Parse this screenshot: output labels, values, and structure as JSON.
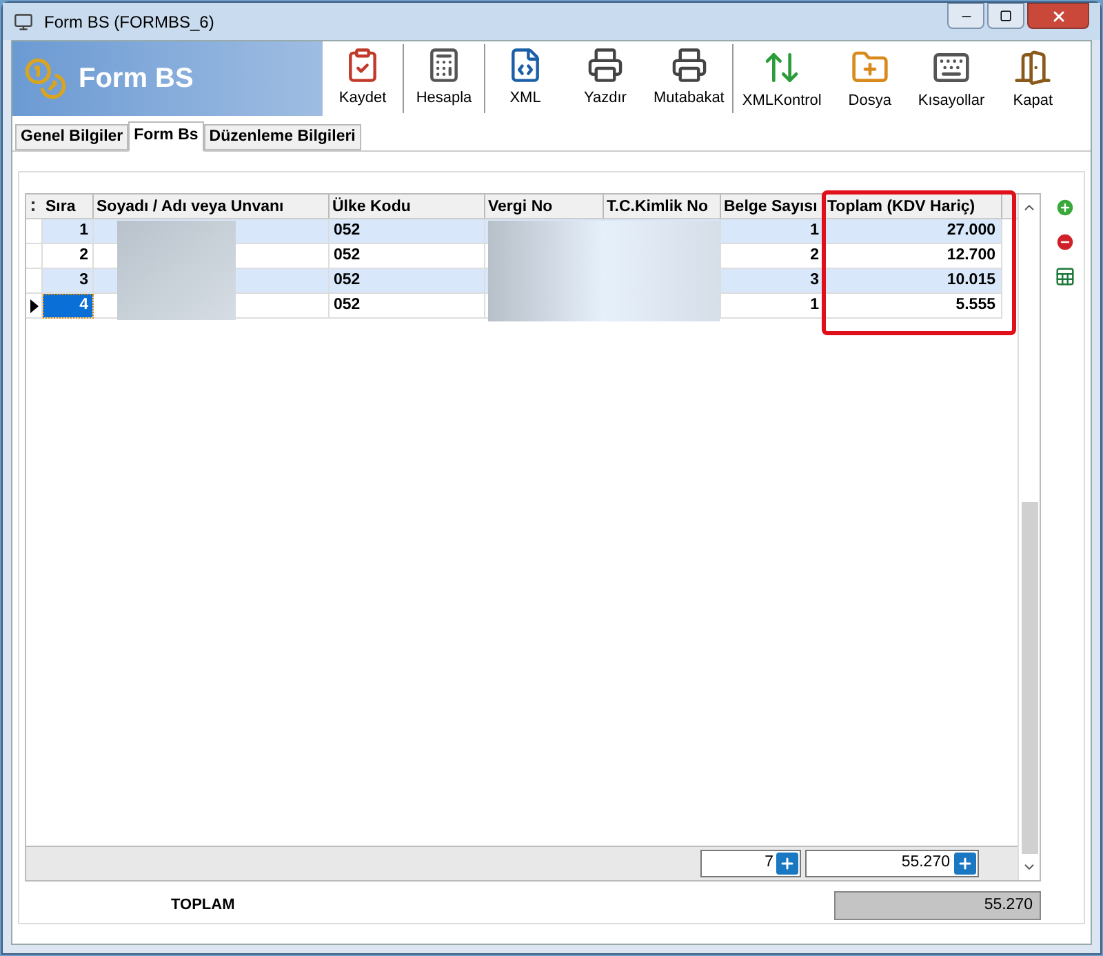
{
  "window": {
    "title": "Form BS (FORMBS_6)"
  },
  "header": {
    "title": "Form BS"
  },
  "toolbar_groups": [
    [
      {
        "label": "Kaydet"
      }
    ],
    [
      {
        "label": "Hesapla"
      }
    ],
    [
      {
        "label": "XML"
      },
      {
        "label": "Yazdır"
      },
      {
        "label": "Mutabakat"
      }
    ],
    [
      {
        "label": "XMLKontrol"
      },
      {
        "label": "Dosya"
      },
      {
        "label": "Kısayollar"
      },
      {
        "label": "Kapat"
      }
    ]
  ],
  "tabs": [
    {
      "label": "Genel Bilgiler",
      "selected": false
    },
    {
      "label": "Form Bs",
      "selected": true
    },
    {
      "label": "Düzenleme Bilgileri",
      "selected": false
    }
  ],
  "table": {
    "columns": [
      "Sıra",
      "Soyadı / Adı veya Unvanı",
      "Ülke Kodu",
      "Vergi No",
      "T.C.Kimlik No",
      "Belge Sayısı",
      "Toplam (KDV Hariç)"
    ],
    "rows": [
      {
        "sira": "1",
        "ulke": "052",
        "belge": "1",
        "toplam": "27.000",
        "selected": false
      },
      {
        "sira": "2",
        "ulke": "052",
        "belge": "2",
        "toplam": "12.700",
        "selected": false
      },
      {
        "sira": "3",
        "ulke": "052",
        "belge": "3",
        "toplam": "10.015",
        "selected": false
      },
      {
        "sira": "4",
        "ulke": "052",
        "belge": "1",
        "toplam": "5.555",
        "selected": true
      }
    ],
    "footer": {
      "belge_total": "7",
      "toplam_total": "55.270"
    }
  },
  "summary": {
    "label": "TOPLAM",
    "value": "55.270"
  }
}
